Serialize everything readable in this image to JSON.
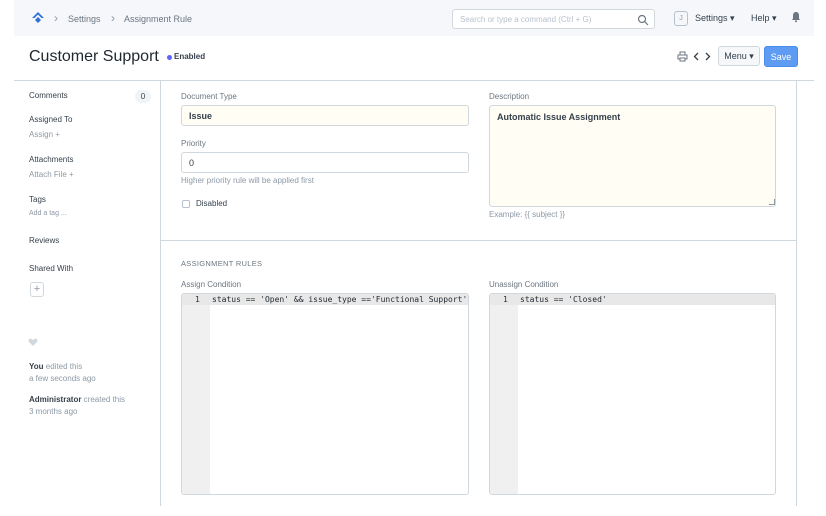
{
  "navbar": {
    "breadcrumbs": [
      "Settings",
      "Assignment Rule"
    ],
    "search_placeholder": "Search or type a command (Ctrl + G)",
    "avatar_initial": "J",
    "settings_label": "Settings",
    "help_label": "Help"
  },
  "header": {
    "title": "Customer Support",
    "status": "Enabled",
    "menu_label": "Menu",
    "save_label": "Save"
  },
  "sidebar": {
    "comments_label": "Comments",
    "comments_count": "0",
    "assigned_to_label": "Assigned To",
    "assign_action": "Assign +",
    "attachments_label": "Attachments",
    "attach_action": "Attach File +",
    "tags_label": "Tags",
    "tag_action": "Add a tag ...",
    "reviews_label": "Reviews",
    "shared_with_label": "Shared With",
    "shared_plus": "+",
    "timeline": [
      {
        "user": "You",
        "action": " edited this",
        "time": "a few seconds ago"
      },
      {
        "user": "Administrator",
        "action": " created this",
        "time": "3 months ago"
      }
    ]
  },
  "form": {
    "document_type_label": "Document Type",
    "document_type_value": "Issue",
    "priority_label": "Priority",
    "priority_value": "0",
    "priority_help": "Higher priority rule will be applied first",
    "disabled_label": "Disabled",
    "description_label": "Description",
    "description_value": "Automatic Issue Assignment",
    "description_help": "Example: {{ subject }}"
  },
  "assignment_rules": {
    "section_title": "ASSIGNMENT RULES",
    "assign_condition_label": "Assign Condition",
    "assign_condition_line_no": "1",
    "assign_condition_code": "status == 'Open' && issue_type =='Functional Support'",
    "unassign_condition_label": "Unassign Condition",
    "unassign_condition_line_no": "1",
    "unassign_condition_code": "status == 'Closed'"
  },
  "colors": {
    "accent": "#5e64ff",
    "save_button": "#5e9bf2"
  }
}
